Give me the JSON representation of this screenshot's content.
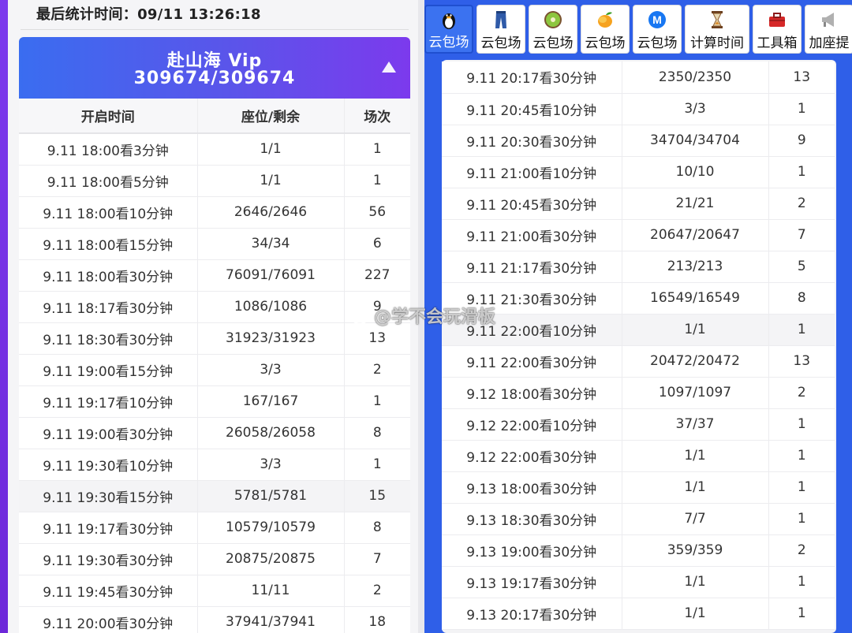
{
  "stats": {
    "last_update": "最后统计时间：09/11 13:26:18"
  },
  "vip": {
    "title": "赴山海 Vip",
    "count": "309674/309674"
  },
  "columns": [
    "开启时间",
    "座位/剩余",
    "场次"
  ],
  "left_rows": [
    [
      "9.11 18:00看3分钟",
      "1/1",
      "1"
    ],
    [
      "9.11 18:00看5分钟",
      "1/1",
      "1"
    ],
    [
      "9.11 18:00看10分钟",
      "2646/2646",
      "56"
    ],
    [
      "9.11 18:00看15分钟",
      "34/34",
      "6"
    ],
    [
      "9.11 18:00看30分钟",
      "76091/76091",
      "227"
    ],
    [
      "9.11 18:17看30分钟",
      "1086/1086",
      "9"
    ],
    [
      "9.11 18:30看30分钟",
      "31923/31923",
      "13"
    ],
    [
      "9.11 19:00看15分钟",
      "3/3",
      "2"
    ],
    [
      "9.11 19:17看10分钟",
      "167/167",
      "1"
    ],
    [
      "9.11 19:00看30分钟",
      "26058/26058",
      "8"
    ],
    [
      "9.11 19:30看10分钟",
      "3/3",
      "1"
    ],
    [
      "9.11 19:30看15分钟",
      "5781/5781",
      "15"
    ],
    [
      "9.11 19:17看30分钟",
      "10579/10579",
      "8"
    ],
    [
      "9.11 19:30看30分钟",
      "20875/20875",
      "7"
    ],
    [
      "9.11 19:45看30分钟",
      "11/11",
      "2"
    ],
    [
      "9.11 20:00看30分钟",
      "37941/37941",
      "18"
    ]
  ],
  "toolbar": [
    {
      "label": "云包场",
      "icon": "penguin-icon",
      "active": true
    },
    {
      "label": "云包场",
      "icon": "jeans-icon"
    },
    {
      "label": "云包场",
      "icon": "kiwi-icon"
    },
    {
      "label": "云包场",
      "icon": "mango-icon"
    },
    {
      "label": "云包场",
      "icon": "m-logo-icon"
    },
    {
      "label": "计算时间",
      "icon": "hourglass-icon"
    },
    {
      "label": "工具箱",
      "icon": "toolbox-icon"
    },
    {
      "label": "加座提",
      "icon": "megaphone-icon"
    }
  ],
  "right_rows": [
    [
      "9.11 20:17看30分钟",
      "2350/2350",
      "13"
    ],
    [
      "9.11 20:45看10分钟",
      "3/3",
      "1"
    ],
    [
      "9.11 20:30看30分钟",
      "34704/34704",
      "9"
    ],
    [
      "9.11 21:00看10分钟",
      "10/10",
      "1"
    ],
    [
      "9.11 20:45看30分钟",
      "21/21",
      "2"
    ],
    [
      "9.11 21:00看30分钟",
      "20647/20647",
      "7"
    ],
    [
      "9.11 21:17看30分钟",
      "213/213",
      "5"
    ],
    [
      "9.11 21:30看30分钟",
      "16549/16549",
      "8"
    ],
    [
      "9.11 22:00看10分钟",
      "1/1",
      "1"
    ],
    [
      "9.11 22:00看30分钟",
      "20472/20472",
      "13"
    ],
    [
      "9.12 18:00看30分钟",
      "1097/1097",
      "2"
    ],
    [
      "9.12 22:00看10分钟",
      "37/37",
      "1"
    ],
    [
      "9.12 22:00看30分钟",
      "1/1",
      "1"
    ],
    [
      "9.13 18:00看30分钟",
      "1/1",
      "1"
    ],
    [
      "9.13 18:30看30分钟",
      "7/7",
      "1"
    ],
    [
      "9.13 19:00看30分钟",
      "359/359",
      "2"
    ],
    [
      "9.13 19:17看30分钟",
      "1/1",
      "1"
    ],
    [
      "9.13 20:17看30分钟",
      "1/1",
      "1"
    ]
  ],
  "watermark": "@学不会玩滑板",
  "colors": {
    "accent_blue": "#3a6df0",
    "accent_purple": "#7c3aed",
    "page_blue": "#2f5fe8"
  }
}
